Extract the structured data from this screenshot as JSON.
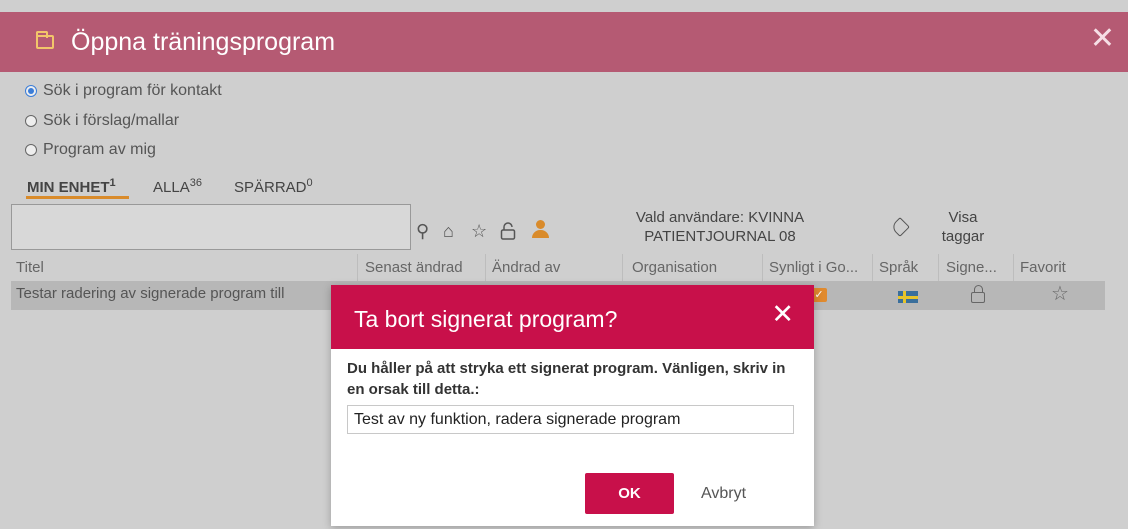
{
  "window": {
    "title": "Öppna träningsprogram",
    "close_glyph": "✕"
  },
  "search_options": [
    {
      "label": "Sök i program för kontakt",
      "checked": true
    },
    {
      "label": "Sök i förslag/mallar",
      "checked": false
    },
    {
      "label": "Program av mig",
      "checked": false
    }
  ],
  "tabs": [
    {
      "label": "MIN ENHET",
      "count": "1",
      "active": true
    },
    {
      "label": "ALLA",
      "count": "36",
      "active": false
    },
    {
      "label": "SPÄRRAD",
      "count": "0",
      "active": false
    }
  ],
  "toolbar": {
    "search_value": "",
    "icons": [
      "search-icon",
      "home-icon",
      "star-icon",
      "unlock-icon",
      "user-icon"
    ],
    "selected_user_line1": "Vald användare: KVINNA",
    "selected_user_line2": "PATIENTJOURNAL 08",
    "show_tags_line1": "Visa",
    "show_tags_line2": "taggar"
  },
  "table": {
    "columns": [
      "Titel",
      "Senast ändrad",
      "Ändrad av",
      "Organisation",
      "Synligt i Go...",
      "Språk",
      "Signe...",
      "Favorit"
    ],
    "rows": [
      {
        "title": "Testar radering av signerade program till",
        "visible": "✓",
        "language": "sv-flag",
        "signed": "lock-icon",
        "favorite": "☆"
      }
    ]
  },
  "dialog": {
    "title": "Ta bort signerat program?",
    "close_glyph": "✕",
    "message": "Du håller på att stryka ett signerat program. Vänligen, skriv in en orsak till detta.:",
    "reason_value": "Test av ny funktion, radera signerade program",
    "ok_label": "OK",
    "cancel_label": "Avbryt"
  },
  "colors": {
    "titlebar": "#b55a73",
    "dialog_header": "#c8104a",
    "accent_orange": "#d98b2b"
  }
}
